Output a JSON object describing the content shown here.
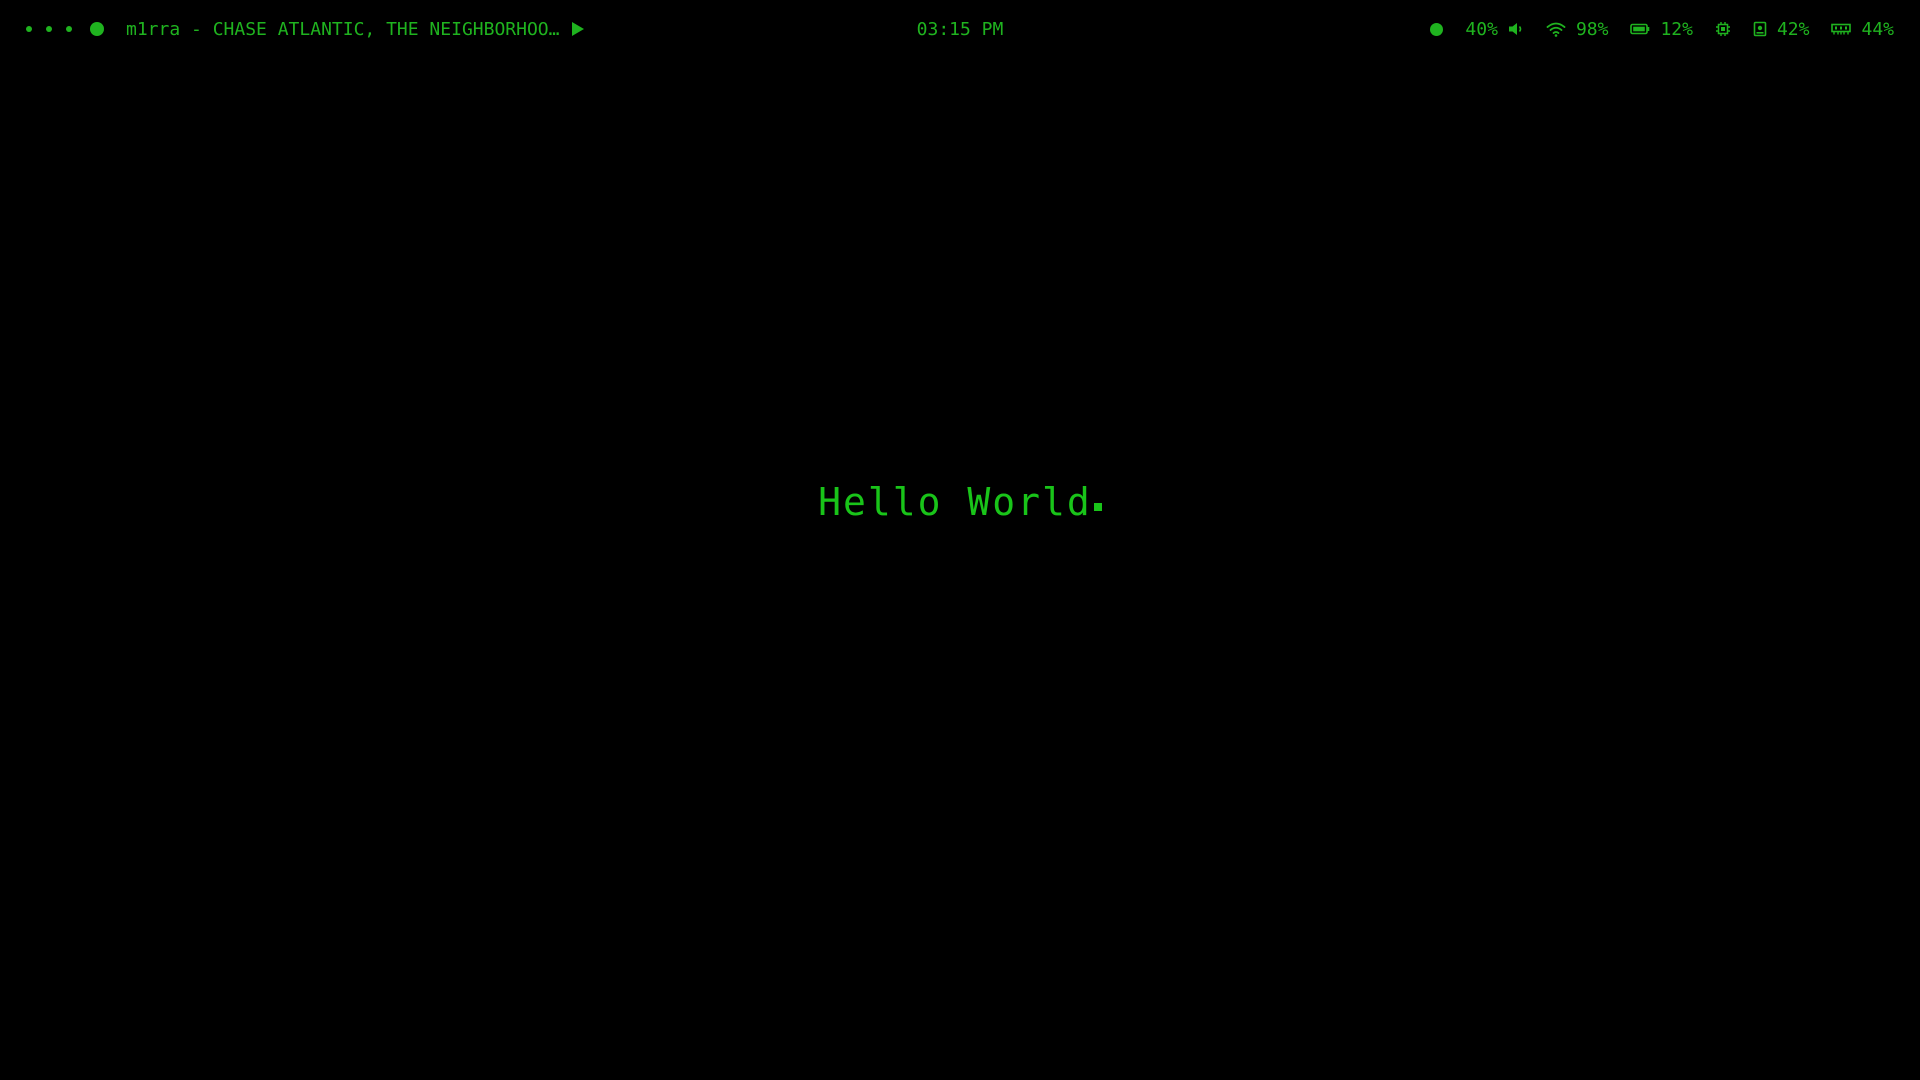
{
  "topbar": {
    "workspaces": [
      {
        "active": false
      },
      {
        "active": false
      },
      {
        "active": false
      },
      {
        "active": true
      }
    ],
    "media": {
      "title": "m1rra - CHASE ATLANTIC, THE NEIGHBORHOO…",
      "play_icon": "play-icon"
    },
    "clock": "03:15 PM",
    "status": {
      "volume": "40%",
      "wifi": "98%",
      "battery": "12%",
      "disk": "42%",
      "memory": "44%"
    }
  },
  "main": {
    "text": "Hello World"
  },
  "colors": {
    "accent": "#1fb31f",
    "background": "#000000"
  }
}
